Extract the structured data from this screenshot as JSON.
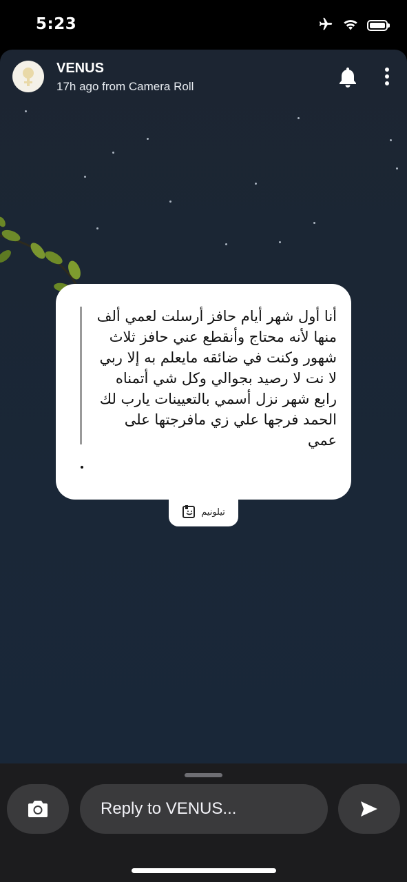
{
  "status_bar": {
    "time": "5:23",
    "icons": [
      "airplane-icon",
      "wifi-icon",
      "battery-icon"
    ]
  },
  "story": {
    "username": "VENUS",
    "subtitle": "17h ago from Camera Roll",
    "avatar_icon": "venus-symbol-icon",
    "header_icons": [
      "bell-icon",
      "more-vertical-icon"
    ],
    "background_color": "#1b2634"
  },
  "quote": {
    "text": "أنا أول شهر أيام حافز أرسلت لعمي ألف منها لأنه محتاج وأنقطع عني حافز ثلاث شهور وكنت في ضائقه مايعلم به إلا ربي لا نت لا رصيد بجوالي وكل شي أتمناه رابع شهر نزل أسمي بالتعيينات يارب لك الحمد فرجها علي زي مافرجتها على عمي",
    "trailing_dot": ".",
    "source_label": "تيلونيم",
    "source_icon": "telonym-logo-icon"
  },
  "reply_bar": {
    "placeholder": "Reply to VENUS...",
    "camera_icon": "camera-icon",
    "send_icon": "send-icon"
  }
}
